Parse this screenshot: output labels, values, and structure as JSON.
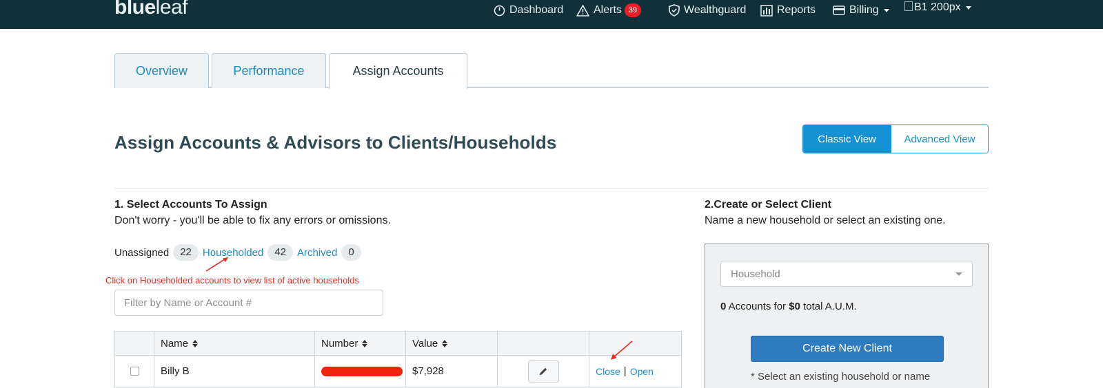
{
  "nav": {
    "logo_left": "blue",
    "logo_right": "leaf",
    "items": [
      {
        "label": "Dashboard",
        "icon": "dashboard-icon"
      },
      {
        "label": "Alerts",
        "icon": "alert-icon",
        "badge": "39"
      },
      {
        "label": "Wealthguard",
        "icon": "shield-icon"
      },
      {
        "label": "Reports",
        "icon": "bar-chart-icon"
      },
      {
        "label": "Billing",
        "icon": "credit-card-icon"
      }
    ],
    "user_image_alt": "B1 200px"
  },
  "tabs": [
    {
      "label": "Overview",
      "active": false
    },
    {
      "label": "Performance",
      "active": false
    },
    {
      "label": "Assign Accounts",
      "active": true
    }
  ],
  "page": {
    "title": "Assign Accounts & Advisors to Clients/Households",
    "classic_view": "Classic View",
    "advanced_view": "Advanced View"
  },
  "section1": {
    "title": "1. Select Accounts To Assign",
    "subtitle": "Don't worry - you'll be able to fix any errors or omissions.",
    "filters": [
      {
        "label": "Unassigned",
        "count": "22"
      },
      {
        "label": "Householded",
        "count": "42"
      },
      {
        "label": "Archived",
        "count": "0"
      }
    ],
    "annotation": "Click on Householded accounts to view list of active households",
    "filter_placeholder": "Filter by Name or Account #",
    "table": {
      "headers": [
        "",
        "Name",
        "Number",
        "Value",
        "",
        ""
      ],
      "rows": [
        {
          "name": "Billy B",
          "number": "",
          "value": "$7,928",
          "close": "Close",
          "open": "Open"
        }
      ]
    }
  },
  "section2": {
    "title": "2.Create or Select Client",
    "subtitle": "Name a new household or select an existing one.",
    "select_placeholder": "Household",
    "summary_count": "0",
    "summary_mid": " Accounts for ",
    "summary_value": "$0",
    "summary_tail": " total A.U.M.",
    "create_button": "Create New Client",
    "hint": "* Select an existing household or name"
  },
  "colors": {
    "navbar": "#10303a",
    "accent": "#1592d6",
    "link": "#1a8cc9",
    "annotation": "#e82a1f",
    "primary_button": "#2f7bbf"
  }
}
